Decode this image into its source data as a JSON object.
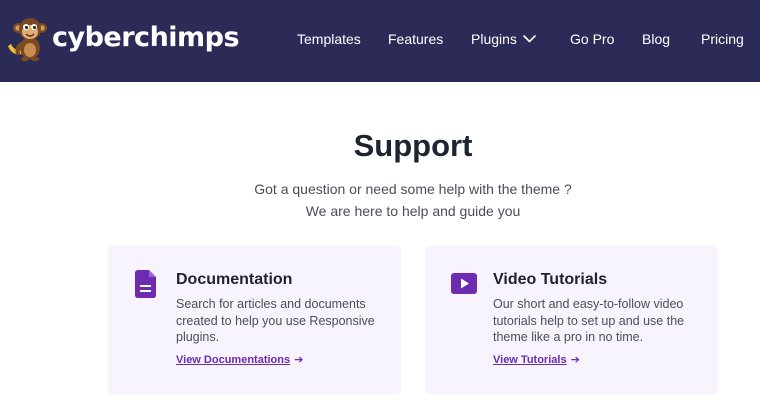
{
  "brand": {
    "name": "cyberchimps"
  },
  "nav": {
    "items": [
      {
        "label": "Templates"
      },
      {
        "label": "Features"
      },
      {
        "label": "Plugins"
      },
      {
        "label": "Go Pro"
      },
      {
        "label": "Blog"
      },
      {
        "label": "Pricing"
      }
    ]
  },
  "hero": {
    "title": "Support",
    "line1": "Got a question or need some help with the theme ?",
    "line2": "We are here to help and guide you"
  },
  "cards": [
    {
      "title": "Documentation",
      "description": "Search for articles and documents created to help you use Responsive plugins.",
      "link": "View Documentations",
      "icon": "document-icon"
    },
    {
      "title": "Video Tutorials",
      "description": "Our short and easy-to-follow video tutorials help to set up and use the theme like a pro in no time.",
      "link": "View Tutorials",
      "icon": "play-icon"
    }
  ],
  "colors": {
    "header_bg": "#2c2b58",
    "accent": "#6c2bb1",
    "card_bg": "#f8f4fe"
  }
}
